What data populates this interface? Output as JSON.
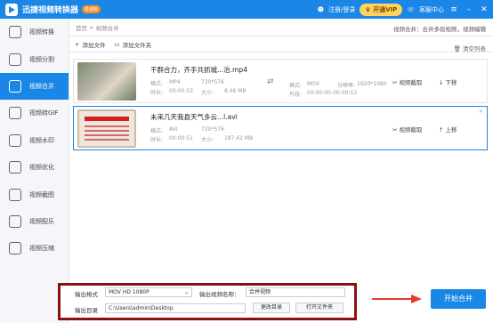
{
  "app": {
    "title": "迅捷视频转换器",
    "version_badge": "极速版"
  },
  "header": {
    "login": "注册/登录",
    "vip": "开通VIP",
    "support": "客服中心"
  },
  "sidebar": {
    "items": [
      {
        "label": "视频转换"
      },
      {
        "label": "视频分割"
      },
      {
        "label": "视频合并",
        "active": true
      },
      {
        "label": "视频转GIF"
      },
      {
        "label": "视频水印"
      },
      {
        "label": "视频优化"
      },
      {
        "label": "视频截图"
      },
      {
        "label": "视频配乐"
      },
      {
        "label": "视频压缩"
      }
    ]
  },
  "breadcrumb": {
    "home": "首页",
    "current": "视频合并",
    "hint": "视频合并：合并多段视频，视频编辑"
  },
  "toolbar": {
    "add_file": "添加文件",
    "add_folder": "添加文件夹",
    "clear": "清空列表"
  },
  "files": [
    {
      "name": "干群合力，齐手共抓城...治.mp4",
      "format_label": "格式:",
      "format": "MP4",
      "res": "720*576",
      "duration_label": "时长:",
      "duration": "00:00:53",
      "size_label": "大小:",
      "size": "8.46 MB",
      "out_format_label": "格式:",
      "out_format": "MOV",
      "out_res_label": "分辨率:",
      "out_res": "1920*1080",
      "clip_label": "片段:",
      "clip": "00:00:00-00:00:53",
      "action_edit": "视频截取",
      "action_move": "下移"
    },
    {
      "name": "未来几天我县天气多云...l.avi",
      "format_label": "格式:",
      "format": "AVI",
      "res": "720*576",
      "duration_label": "时长:",
      "duration": "00:00:51",
      "size_label": "大小:",
      "size": "187.62 MB",
      "action_edit": "视频截取",
      "action_move": "上移"
    }
  ],
  "output": {
    "format_label": "输出格式",
    "format_value": "MOV  HD 1080P",
    "name_label": "输出视频名称：",
    "name_value": "合并视频",
    "dir_label": "输出目录",
    "dir_value": "C:\\Users\\admin\\Desktop",
    "change_dir": "更改目录",
    "open_folder": "打开文件夹"
  },
  "start_button": "开始合并",
  "colors": {
    "accent": "#1a86e6",
    "highlight_box": "#8b1111",
    "arrow": "#e33b2f"
  }
}
